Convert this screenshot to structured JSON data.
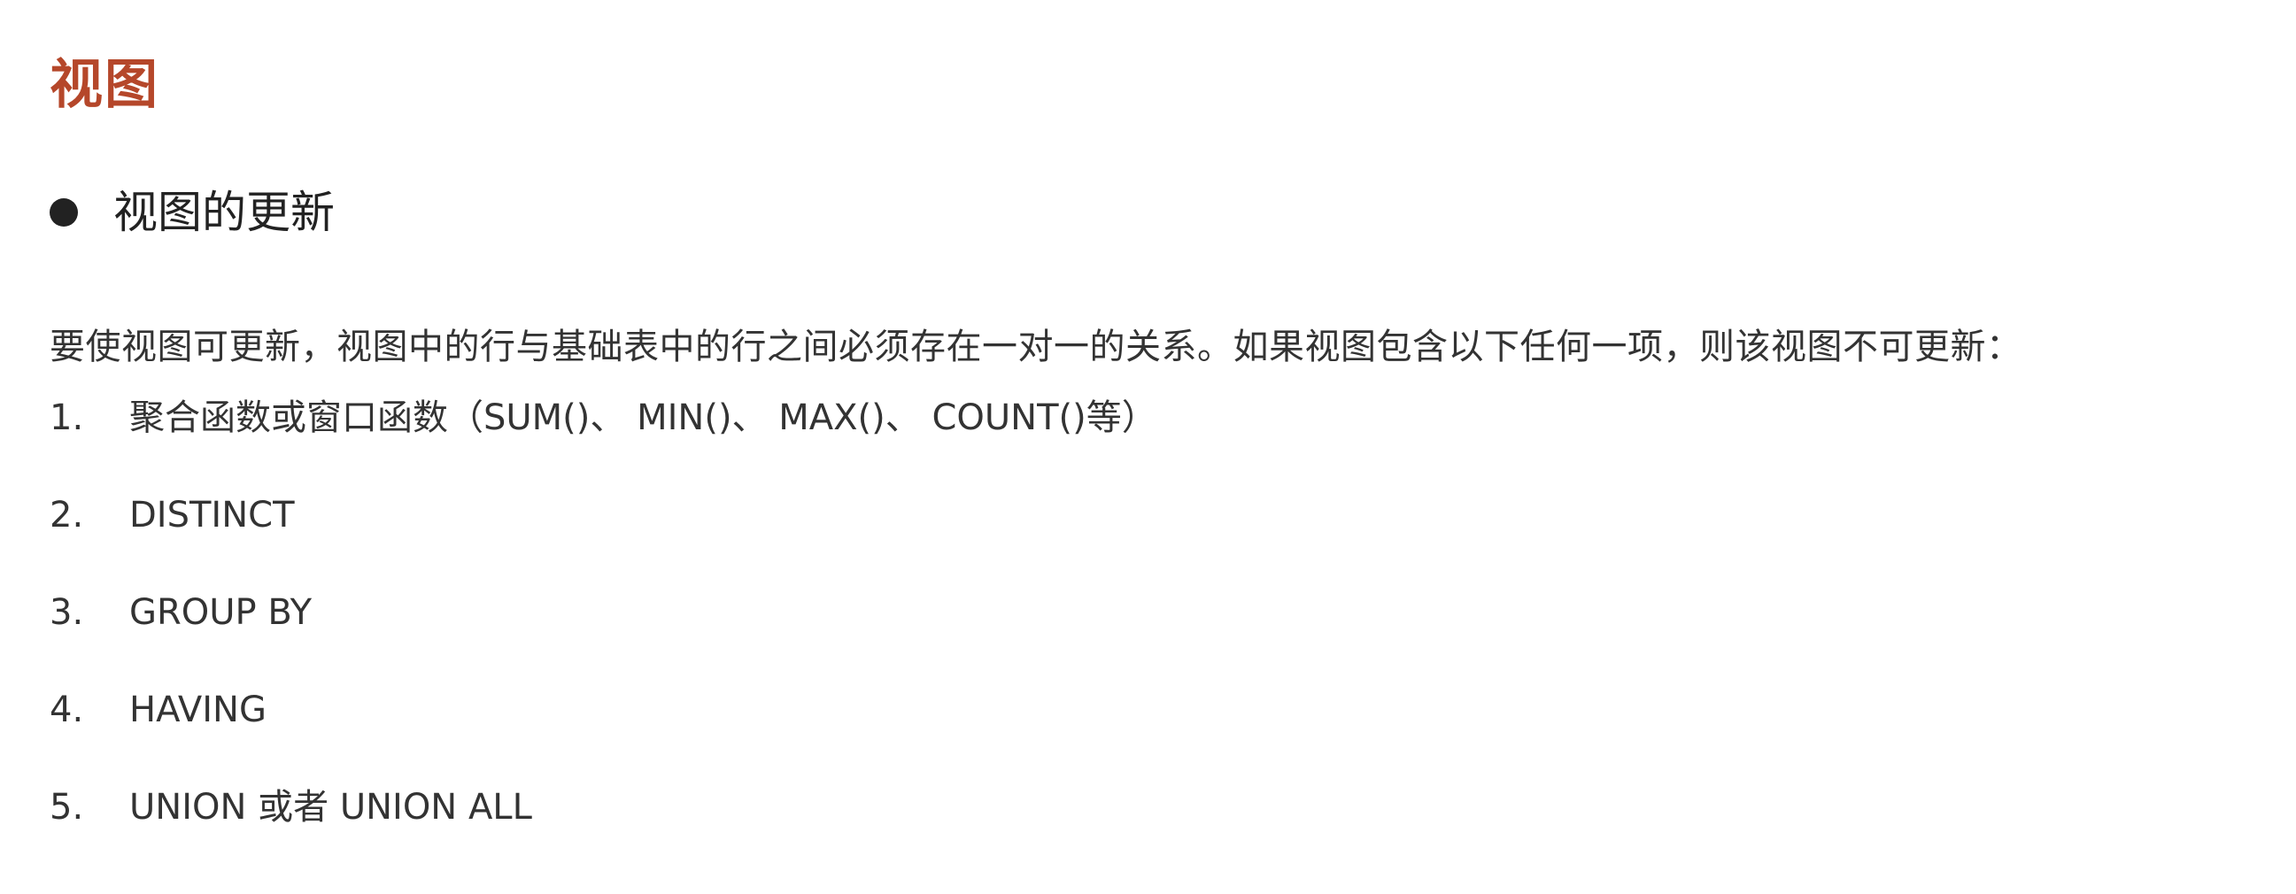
{
  "colors": {
    "title": "#b5472a",
    "heading": "#222222",
    "body": "#333333"
  },
  "page": {
    "title": "视图"
  },
  "section": {
    "bullet_icon": "filled-circle",
    "heading": "视图的更新",
    "intro": "要使视图可更新，视图中的行与基础表中的行之间必须存在一对一的关系。如果视图包含以下任何一项，则该视图不可更新："
  },
  "items": [
    {
      "number": "1.",
      "text": "聚合函数或窗口函数（SUM()、 MIN()、 MAX()、 COUNT()等）"
    },
    {
      "number": "2.",
      "text": "DISTINCT"
    },
    {
      "number": "3.",
      "text": "GROUP BY"
    },
    {
      "number": "4.",
      "text": "HAVING"
    },
    {
      "number": "5.",
      "text": "UNION 或者 UNION ALL"
    }
  ]
}
